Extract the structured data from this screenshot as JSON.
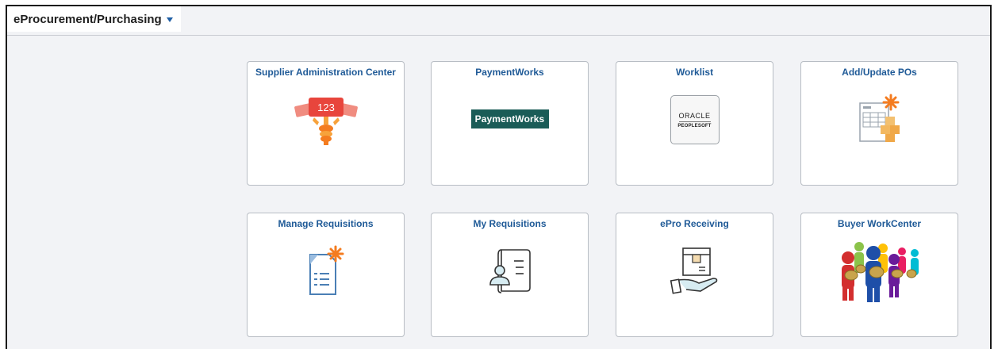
{
  "header": {
    "title": "eProcurement/Purchasing",
    "menu_icon": "chevron-down-icon"
  },
  "tiles": [
    {
      "title": "Supplier Administration Center",
      "icon": "supplier-ticket-icon",
      "icon_text": "123"
    },
    {
      "title": "PaymentWorks",
      "icon": "paymentworks-logo",
      "logo_text": "PaymentWorks"
    },
    {
      "title": "Worklist",
      "icon": "oracle-peoplesoft-logo",
      "logo_text": "ORACLE",
      "logo_subtext": "PEOPLESOFT"
    },
    {
      "title": "Add/Update POs",
      "icon": "purchase-order-icon"
    },
    {
      "title": "Manage Requisitions",
      "icon": "requisition-document-icon"
    },
    {
      "title": "My Requisitions",
      "icon": "my-requisitions-icon"
    },
    {
      "title": "ePro Receiving",
      "icon": "receiving-package-icon"
    },
    {
      "title": "Buyer WorkCenter",
      "icon": "buyers-group-icon"
    }
  ],
  "colors": {
    "tile_title": "#1f5a97",
    "accent_orange": "#f47c20",
    "paymentworks_green": "#1a5c57",
    "ticket_red": "#e8453c"
  }
}
